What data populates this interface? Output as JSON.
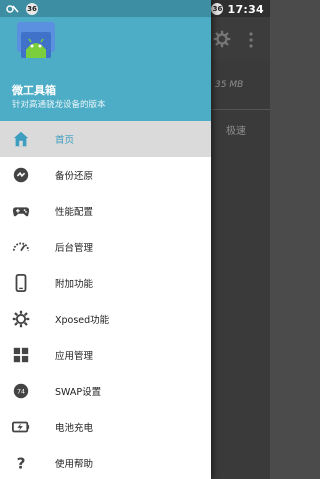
{
  "status_bar": {
    "time": "17:34",
    "notification_badge": "36",
    "battery_badge": "36"
  },
  "background_app": {
    "partial_text": "35 MB",
    "partial_button": "极速"
  },
  "drawer": {
    "app_name": "微工具箱",
    "app_subtitle": "针对高通骁龙设备的版本",
    "menu_items": [
      {
        "label": "首页",
        "icon": "home-icon",
        "active": true
      },
      {
        "label": "备份还原",
        "icon": "restore-icon",
        "active": false
      },
      {
        "label": "性能配置",
        "icon": "gamepad-icon",
        "active": false
      },
      {
        "label": "后台管理",
        "icon": "speedometer-icon",
        "active": false
      },
      {
        "label": "附加功能",
        "icon": "phone-icon",
        "active": false
      },
      {
        "label": "Xposed功能",
        "icon": "gear-icon",
        "active": false
      },
      {
        "label": "应用管理",
        "icon": "grid-icon",
        "active": false
      },
      {
        "label": "SWAP设置",
        "icon": "swap-icon",
        "active": false
      },
      {
        "label": "电池充电",
        "icon": "battery-icon",
        "active": false
      },
      {
        "label": "使用帮助",
        "icon": "help-icon",
        "active": false
      }
    ]
  },
  "colors": {
    "drawer_header": "#4eadc6",
    "active_item_bg": "#dadada",
    "active_label": "#3e9ec0"
  }
}
